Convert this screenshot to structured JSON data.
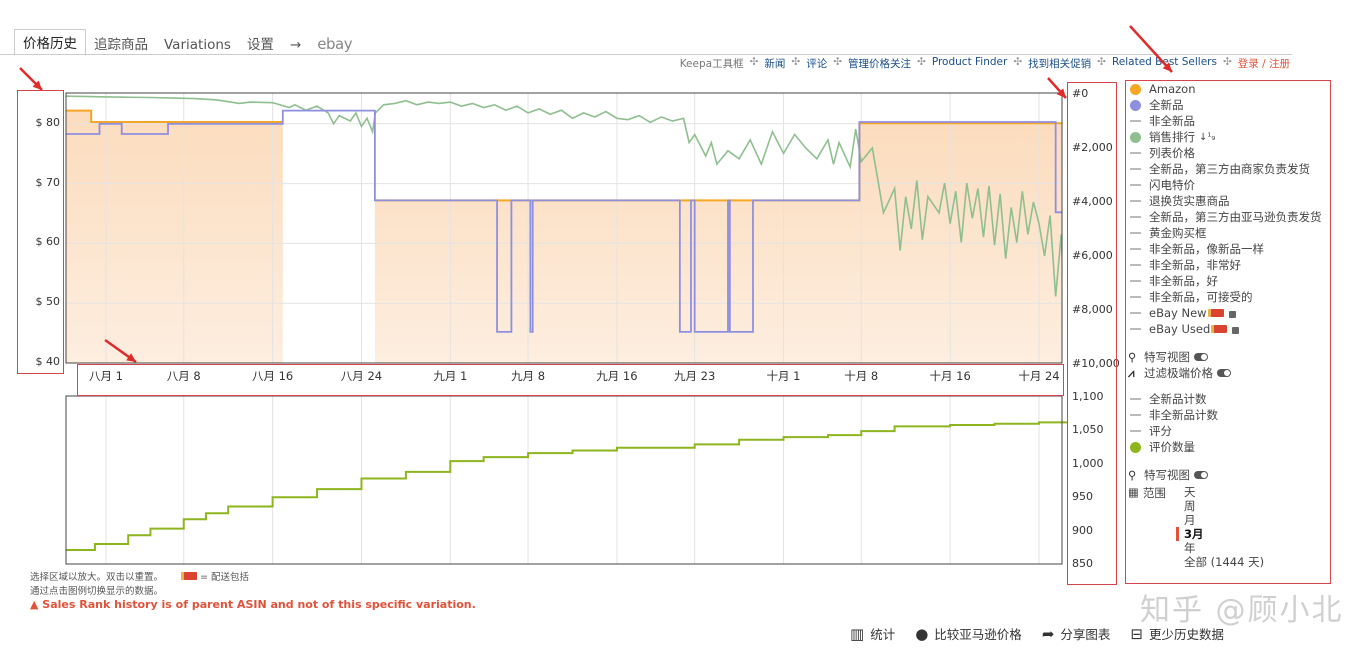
{
  "tabs": [
    {
      "label": "价格历史",
      "active": true
    },
    {
      "label": "追踪商品"
    },
    {
      "label": "Variations"
    },
    {
      "label": "设置"
    },
    {
      "label": "→"
    },
    {
      "label": "ebay"
    }
  ],
  "top_links": [
    {
      "label": "Keepa工具框"
    },
    {
      "label": "新闻"
    },
    {
      "label": "评论"
    },
    {
      "label": "管理价格关注"
    },
    {
      "label": "Product Finder"
    },
    {
      "label": "找到相关促销"
    },
    {
      "label": "Related Best Sellers"
    },
    {
      "label": "登录 / 注册"
    }
  ],
  "top_links_separator": "✣",
  "legend": {
    "series": [
      {
        "label": "Amazon",
        "marker": "dot",
        "color": "#f5a623"
      },
      {
        "label": "全新品",
        "marker": "dot",
        "color": "#8f8fe0"
      },
      {
        "label": "非全新品",
        "marker": "dash"
      },
      {
        "label": "销售排行",
        "marker": "dot",
        "color": "#8fbf8f",
        "suffix": "↓¹₉"
      },
      {
        "label": "列表价格",
        "marker": "dash"
      },
      {
        "label": "全新品，第三方由商家负责发货",
        "marker": "dash"
      },
      {
        "label": "闪电特价",
        "marker": "dash"
      },
      {
        "label": "退换货实惠商品",
        "marker": "dash"
      },
      {
        "label": "全新品，第三方由亚马逊负责发货",
        "marker": "dash"
      },
      {
        "label": "黄金购买框",
        "marker": "dash"
      },
      {
        "label": "非全新品，像新品一样",
        "marker": "dash"
      },
      {
        "label": "非全新品，非常好",
        "marker": "dash"
      },
      {
        "label": "非全新品，好",
        "marker": "dash"
      },
      {
        "label": "非全新品，可接受的",
        "marker": "dash"
      },
      {
        "label": "eBay New",
        "marker": "dash",
        "ebay": true
      },
      {
        "label": "eBay Used",
        "marker": "dash",
        "ebay": true
      }
    ],
    "closeup_view": "特写视图",
    "filter_extreme": "过滤极端价格",
    "count_series": [
      {
        "label": "全新品计数",
        "marker": "dash"
      },
      {
        "label": "非全新品计数",
        "marker": "dash"
      },
      {
        "label": "评分",
        "marker": "dash"
      },
      {
        "label": "评价数量",
        "marker": "dot",
        "color": "#8db51e"
      }
    ],
    "closeup_view_2": "特写视图",
    "range_label": "范围",
    "range_options": [
      "天",
      "周",
      "月",
      "3月",
      "年",
      "全部 (1444 天)"
    ],
    "range_selected": "3月"
  },
  "notes": {
    "line1": "选择区域以放大。双击以重置。",
    "delivery_legend": "= 配送包括",
    "line2": "通过点击图例切换显示的数据。",
    "warning": "Sales Rank history is of parent ASIN and not of this specific variation."
  },
  "bottom_actions": [
    {
      "label": "统计",
      "icon": "bar-chart-icon"
    },
    {
      "label": "比较亚马逊价格",
      "icon": "globe-icon"
    },
    {
      "label": "分享图表",
      "icon": "share-icon"
    },
    {
      "label": "更少历史数据",
      "icon": "collapse-icon"
    }
  ],
  "watermark": "知乎 @顾小北",
  "chart_data": [
    {
      "type": "line",
      "title": "",
      "x_ticks": [
        {
          "date": "08-01",
          "label": "八月 1"
        },
        {
          "date": "08-08",
          "label": "八月 8"
        },
        {
          "date": "08-16",
          "label": "八月 16"
        },
        {
          "date": "08-24",
          "label": "八月 24"
        },
        {
          "date": "09-01",
          "label": "九月 1"
        },
        {
          "date": "09-08",
          "label": "九月 8"
        },
        {
          "date": "09-16",
          "label": "九月 16"
        },
        {
          "date": "09-23",
          "label": "九月 23"
        },
        {
          "date": "10-01",
          "label": "十月 1"
        },
        {
          "date": "10-08",
          "label": "十月 8"
        },
        {
          "date": "10-16",
          "label": "十月 16"
        },
        {
          "date": "10-24",
          "label": "十月 24"
        }
      ],
      "x_range": [
        "07-28 10",
        "10-26 12"
      ],
      "y_left": {
        "ticks": [
          {
            "v": 80,
            "label": "$ 80"
          },
          {
            "v": 70,
            "label": "$ 70"
          },
          {
            "v": 60,
            "label": "$ 60"
          },
          {
            "v": 50,
            "label": "$ 50"
          },
          {
            "v": 40,
            "label": "$ 40"
          }
        ],
        "range": [
          40,
          85.2
        ]
      },
      "y_right": {
        "ticks": [
          {
            "v": 0,
            "label": "#0"
          },
          {
            "v": 2000,
            "label": "#2,000"
          },
          {
            "v": 4000,
            "label": "#4,000"
          },
          {
            "v": 6000,
            "label": "#6,000"
          },
          {
            "v": 8000,
            "label": "#8,000"
          },
          {
            "v": 10000,
            "label": "#10,000"
          }
        ],
        "range": [
          0,
          10000
        ],
        "inverted": true
      },
      "grid": true,
      "series": [
        {
          "name": "Amazon",
          "color": "#f5a623",
          "axis": "left",
          "step": true,
          "fill": "#fde2c6",
          "segments": [
            [
              [
                "07-28 10",
                82.2
              ],
              [
                "07-30 16",
                80.3
              ],
              [
                "08-16 22",
                80.3
              ]
            ],
            [
              [
                "08-25 05",
                67.2
              ],
              [
                "10-07 20",
                80.1
              ],
              [
                "10-26 12",
                80.1
              ]
            ]
          ]
        },
        {
          "name": "全新品",
          "color": "#8f8fe0",
          "axis": "left",
          "step": true,
          "points": [
            [
              "07-28 10",
              78.3
            ],
            [
              "07-31 10",
              80.0
            ],
            [
              "08-02 10",
              78.3
            ],
            [
              "08-06 14",
              80.0
            ],
            [
              "08-16 22",
              82.2
            ],
            [
              "08-25 05",
              67.2
            ],
            [
              "09-05 05",
              45.2
            ],
            [
              "09-06 12",
              67.2
            ],
            [
              "09-08 05",
              45.2
            ],
            [
              "09-08 10",
              67.2
            ],
            [
              "09-21 16",
              45.2
            ],
            [
              "09-22 16",
              67.2
            ],
            [
              "09-23 00",
              45.2
            ],
            [
              "09-26 00",
              67.2
            ],
            [
              "09-26 04",
              45.2
            ],
            [
              "09-28 06",
              67.2
            ],
            [
              "10-07 20",
              80.3
            ],
            [
              "10-25 12",
              65.2
            ],
            [
              "10-26 04",
              58.2
            ],
            [
              "10-26 12",
              58.2
            ]
          ]
        },
        {
          "name": "销售排行",
          "color": "#8fbf8f",
          "axis": "right",
          "points": [
            [
              "07-28 10",
              80
            ],
            [
              "07-30 00",
              90
            ],
            [
              "08-01 00",
              110
            ],
            [
              "08-03 00",
              120
            ],
            [
              "08-05 00",
              130
            ],
            [
              "08-07 00",
              150
            ],
            [
              "08-09 00",
              170
            ],
            [
              "08-11 00",
              220
            ],
            [
              "08-13 00",
              350
            ],
            [
              "08-14 00",
              300
            ],
            [
              "08-16 00",
              320
            ],
            [
              "08-17 12",
              500
            ],
            [
              "08-18 00",
              400
            ],
            [
              "08-19 00",
              600
            ],
            [
              "08-20 00",
              450
            ],
            [
              "08-21 00",
              700
            ],
            [
              "08-21 12",
              1100
            ],
            [
              "08-22 00",
              800
            ],
            [
              "08-23 00",
              1000
            ],
            [
              "08-23 12",
              700
            ],
            [
              "08-24 00",
              1200
            ],
            [
              "08-24 12",
              900
            ],
            [
              "08-25 00",
              1400
            ],
            [
              "08-25 06",
              700
            ],
            [
              "08-26 00",
              400
            ],
            [
              "08-27 00",
              350
            ],
            [
              "08-28 00",
              250
            ],
            [
              "08-29 00",
              400
            ],
            [
              "08-30 00",
              300
            ],
            [
              "08-31 00",
              350
            ],
            [
              "09-01 00",
              300
            ],
            [
              "09-02 00",
              450
            ],
            [
              "09-03 00",
              350
            ],
            [
              "09-04 00",
              500
            ],
            [
              "09-05 00",
              400
            ],
            [
              "09-06 00",
              600
            ],
            [
              "09-07 00",
              450
            ],
            [
              "09-08 00",
              700
            ],
            [
              "09-09 00",
              550
            ],
            [
              "09-10 00",
              750
            ],
            [
              "09-11 00",
              600
            ],
            [
              "09-12 00",
              900
            ],
            [
              "09-13 00",
              700
            ],
            [
              "09-14 00",
              850
            ],
            [
              "09-15 00",
              650
            ],
            [
              "09-16 00",
              900
            ],
            [
              "09-17 00",
              950
            ],
            [
              "09-18 00",
              800
            ],
            [
              "09-19 00",
              1050
            ],
            [
              "09-20 00",
              850
            ],
            [
              "09-21 00",
              1000
            ],
            [
              "09-22 00",
              900
            ],
            [
              "09-22 12",
              1800
            ],
            [
              "09-23 00",
              1500
            ],
            [
              "09-24 00",
              2300
            ],
            [
              "09-24 12",
              1800
            ],
            [
              "09-25 00",
              2600
            ],
            [
              "09-26 00",
              2100
            ],
            [
              "09-27 00",
              2400
            ],
            [
              "09-28 00",
              1700
            ],
            [
              "09-29 00",
              2600
            ],
            [
              "09-30 00",
              1400
            ],
            [
              "10-01 00",
              2200
            ],
            [
              "10-02 00",
              1500
            ],
            [
              "10-03 00",
              2000
            ],
            [
              "10-04 00",
              2400
            ],
            [
              "10-05 00",
              1700
            ],
            [
              "10-05 12",
              2600
            ],
            [
              "10-06 00",
              1800
            ],
            [
              "10-07 00",
              2700
            ],
            [
              "10-07 12",
              1300
            ],
            [
              "10-08 00",
              2500
            ],
            [
              "10-09 00",
              2000
            ],
            [
              "10-09 12",
              3200
            ],
            [
              "10-10 00",
              4400
            ],
            [
              "10-11 00",
              3500
            ],
            [
              "10-11 12",
              5800
            ],
            [
              "10-12 00",
              3800
            ],
            [
              "10-12 12",
              5000
            ],
            [
              "10-13 00",
              3200
            ],
            [
              "10-13 12",
              5400
            ],
            [
              "10-14 00",
              3800
            ],
            [
              "10-15 00",
              4400
            ],
            [
              "10-15 12",
              3300
            ],
            [
              "10-16 00",
              4800
            ],
            [
              "10-16 12",
              3600
            ],
            [
              "10-17 00",
              5500
            ],
            [
              "10-17 12",
              3300
            ],
            [
              "10-18 00",
              4600
            ],
            [
              "10-18 12",
              3500
            ],
            [
              "10-19 00",
              5300
            ],
            [
              "10-19 12",
              3400
            ],
            [
              "10-20 00",
              5600
            ],
            [
              "10-20 12",
              3700
            ],
            [
              "10-21 00",
              6100
            ],
            [
              "10-21 12",
              4200
            ],
            [
              "10-22 00",
              5500
            ],
            [
              "10-22 12",
              3600
            ],
            [
              "10-23 00",
              5200
            ],
            [
              "10-23 12",
              4000
            ],
            [
              "10-24 00",
              4800
            ],
            [
              "10-24 12",
              6000
            ],
            [
              "10-25 00",
              4500
            ],
            [
              "10-25 12",
              7500
            ],
            [
              "10-26 00",
              5200
            ],
            [
              "10-26 06",
              7700
            ]
          ]
        }
      ]
    },
    {
      "type": "line",
      "title": "",
      "y_right": {
        "ticks": [
          {
            "v": 1100,
            "label": "1,100"
          },
          {
            "v": 1050,
            "label": "1,050"
          },
          {
            "v": 1000,
            "label": "1,000"
          },
          {
            "v": 950,
            "label": "950"
          },
          {
            "v": 900,
            "label": "900"
          },
          {
            "v": 850,
            "label": "850"
          }
        ],
        "range": [
          850,
          1100
        ]
      },
      "grid": true,
      "series": [
        {
          "name": "评价数量",
          "color": "#8db51e",
          "step": true,
          "points": [
            [
              "07-28 10",
              871
            ],
            [
              "07-31 00",
              880
            ],
            [
              "08-03 00",
              893
            ],
            [
              "08-05 00",
              903
            ],
            [
              "08-08 00",
              917
            ],
            [
              "08-10 00",
              926
            ],
            [
              "08-12 00",
              936
            ],
            [
              "08-16 00",
              950
            ],
            [
              "08-20 00",
              962
            ],
            [
              "08-24 00",
              978
            ],
            [
              "08-28 00",
              988
            ],
            [
              "09-01 00",
              1004
            ],
            [
              "09-04 00",
              1010
            ],
            [
              "09-08 00",
              1016
            ],
            [
              "09-12 00",
              1020
            ],
            [
              "09-16 00",
              1024
            ],
            [
              "09-23 00",
              1029
            ],
            [
              "09-27 00",
              1036
            ],
            [
              "10-01 00",
              1040
            ],
            [
              "10-05 00",
              1043
            ],
            [
              "10-08 00",
              1049
            ],
            [
              "10-11 00",
              1056
            ],
            [
              "10-16 00",
              1058
            ],
            [
              "10-20 00",
              1060
            ],
            [
              "10-24 00",
              1062
            ],
            [
              "10-26 12",
              1063
            ]
          ]
        }
      ]
    }
  ]
}
